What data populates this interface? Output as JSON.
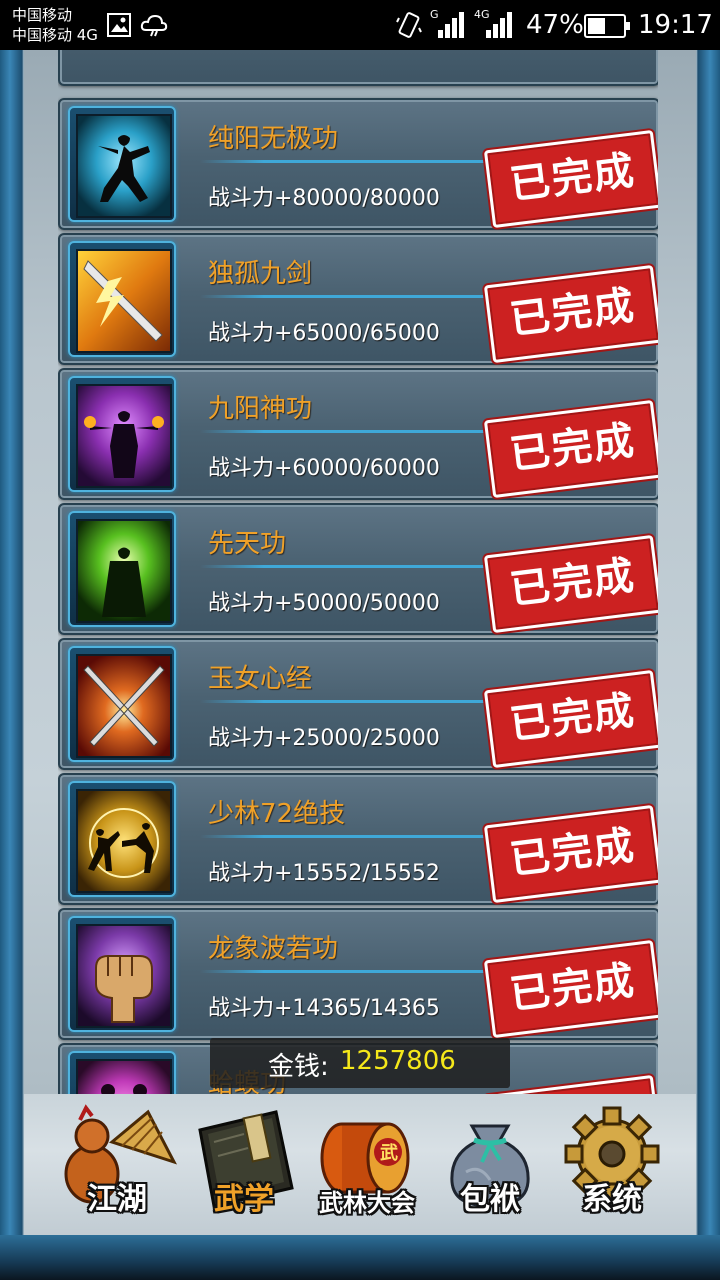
{
  "status_bar": {
    "carrier_line1": "中国移动",
    "carrier_line2": "中国移动 4G",
    "battery": "47%",
    "time": "19:17",
    "signal_labels": [
      "G",
      "4G"
    ]
  },
  "skills": [
    {
      "name": "纯阳无极功",
      "power": "战斗力+80000/80000",
      "status": "已完成",
      "icon": "martial-stance-icon",
      "color": "#2aa0c8"
    },
    {
      "name": "独孤九剑",
      "power": "战斗力+65000/65000",
      "status": "已完成",
      "icon": "sword-lightning-icon",
      "color": "#e07a10"
    },
    {
      "name": "九阳神功",
      "power": "战斗力+60000/60000",
      "status": "已完成",
      "icon": "fire-hands-icon",
      "color": "#8a2fb0"
    },
    {
      "name": "先天功",
      "power": "战斗力+50000/50000",
      "status": "已完成",
      "icon": "green-aura-icon",
      "color": "#58c020"
    },
    {
      "name": "玉女心经",
      "power": "战斗力+25000/25000",
      "status": "已完成",
      "icon": "crossed-swords-icon",
      "color": "#c02a18"
    },
    {
      "name": "少林72绝技",
      "power": "战斗力+15552/15552",
      "status": "已完成",
      "icon": "kungfu-fighters-icon",
      "color": "#c89418"
    },
    {
      "name": "龙象波若功",
      "power": "战斗力+14365/14365",
      "status": "已完成",
      "icon": "fist-icon",
      "color": "#7b3aa8"
    },
    {
      "name": "蛤蟆功",
      "power": "",
      "status": "已完成",
      "icon": "purple-figures-icon",
      "color": "#c03ab8"
    }
  ],
  "gold": {
    "label": "金钱:",
    "value": "1257806"
  },
  "nav": [
    {
      "label": "江湖",
      "icon": "gourd-hat-icon"
    },
    {
      "label": "武学",
      "icon": "book-icon",
      "active": true
    },
    {
      "label": "武林大会",
      "icon": "drum-icon"
    },
    {
      "label": "包袱",
      "icon": "bag-icon"
    },
    {
      "label": "系统",
      "icon": "gear-icon"
    }
  ],
  "colors": {
    "accent_orange": "#f0a128",
    "stamp_red": "#cc2121",
    "gold_yellow": "#f5e81a"
  }
}
